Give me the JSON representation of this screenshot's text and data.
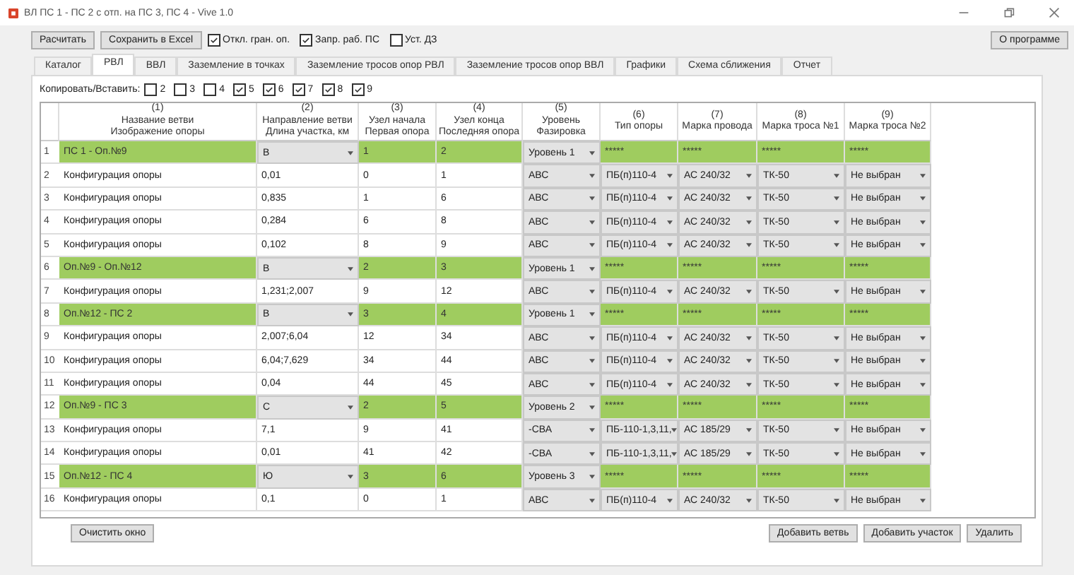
{
  "window": {
    "title": "ВЛ ПС 1 - ПС 2 с отп. на ПС 3, ПС 4 - Vive 1.0"
  },
  "toolbar": {
    "buttons": [
      "Расчитать",
      "Сохранить в Excel"
    ],
    "checks": [
      {
        "label": "Откл. гран. оп.",
        "checked": true
      },
      {
        "label": "Запр. раб. ПС",
        "checked": true
      },
      {
        "label": "Уст. ДЗ",
        "checked": false
      }
    ],
    "about": "О программе"
  },
  "tabs": [
    {
      "label": "Каталог",
      "selected": false
    },
    {
      "label": "РВЛ",
      "selected": true
    },
    {
      "label": "ВВЛ",
      "selected": false
    },
    {
      "label": "Заземление в точках",
      "selected": false
    },
    {
      "label": "Заземление тросов опор РВЛ",
      "selected": false
    },
    {
      "label": "Заземление тросов опор ВВЛ",
      "selected": false
    },
    {
      "label": "Графики",
      "selected": false
    },
    {
      "label": "Схема сближения",
      "selected": false
    },
    {
      "label": "Отчет",
      "selected": false
    }
  ],
  "copy": {
    "label": "Копировать/Вставить:",
    "checks": [
      {
        "label": "2",
        "checked": false
      },
      {
        "label": "3",
        "checked": false
      },
      {
        "label": "4",
        "checked": false
      },
      {
        "label": "5",
        "checked": true
      },
      {
        "label": "6",
        "checked": true
      },
      {
        "label": "7",
        "checked": true
      },
      {
        "label": "8",
        "checked": true
      },
      {
        "label": "9",
        "checked": true
      }
    ]
  },
  "table": {
    "columns": [
      {
        "number": "(1)",
        "lines": [
          "Название ветви",
          "Изображение опоры"
        ]
      },
      {
        "number": "(2)",
        "lines": [
          "Направление ветви",
          "Длина участка, км"
        ]
      },
      {
        "number": "(3)",
        "lines": [
          "Узел начала",
          "Первая опора"
        ]
      },
      {
        "number": "(4)",
        "lines": [
          "Узел конца",
          "Последняя опора"
        ]
      },
      {
        "number": "(5)",
        "lines": [
          "Уровень",
          "Фазировка"
        ]
      },
      {
        "number": "(6)",
        "lines": [
          "Тип опоры"
        ]
      },
      {
        "number": "(7)",
        "lines": [
          "Марка провода"
        ]
      },
      {
        "number": "(8)",
        "lines": [
          "Марка троса №1"
        ]
      },
      {
        "number": "(9)",
        "lines": [
          "Марка троса №2"
        ]
      }
    ],
    "rows": [
      {
        "kind": "branch",
        "num": "1",
        "cells": [
          "ПС 1 - Оп.№9",
          "В",
          "1",
          "2",
          "Уровень 1",
          "*****",
          "*****",
          "*****",
          "*****"
        ]
      },
      {
        "kind": "section",
        "num": "2",
        "cells": [
          "Конфигурация опоры",
          "0,01",
          "0",
          "1",
          "АВС",
          "ПБ(п)110-4",
          "АС 240/32",
          "ТК-50",
          "Не выбран"
        ]
      },
      {
        "kind": "section",
        "num": "3",
        "cells": [
          "Конфигурация опоры",
          "0,835",
          "1",
          "6",
          "АВС",
          "ПБ(п)110-4",
          "АС 240/32",
          "ТК-50",
          "Не выбран"
        ]
      },
      {
        "kind": "section",
        "num": "4",
        "cells": [
          "Конфигурация опоры",
          "0,284",
          "6",
          "8",
          "АВС",
          "ПБ(п)110-4",
          "АС 240/32",
          "ТК-50",
          "Не выбран"
        ]
      },
      {
        "kind": "section",
        "num": "5",
        "cells": [
          "Конфигурация опоры",
          "0,102",
          "8",
          "9",
          "АВС",
          "ПБ(п)110-4",
          "АС 240/32",
          "ТК-50",
          "Не выбран"
        ]
      },
      {
        "kind": "branch",
        "num": "6",
        "cells": [
          "Оп.№9 - Оп.№12",
          "В",
          "2",
          "3",
          "Уровень 1",
          "*****",
          "*****",
          "*****",
          "*****"
        ]
      },
      {
        "kind": "section",
        "num": "7",
        "cells": [
          "Конфигурация опоры",
          "1,231;2,007",
          "9",
          "12",
          "АВС",
          "ПБ(п)110-4",
          "АС 240/32",
          "ТК-50",
          "Не выбран"
        ]
      },
      {
        "kind": "branch",
        "num": "8",
        "cells": [
          "Оп.№12 - ПС 2",
          "В",
          "3",
          "4",
          "Уровень 1",
          "*****",
          "*****",
          "*****",
          "*****"
        ]
      },
      {
        "kind": "section",
        "num": "9",
        "cells": [
          "Конфигурация опоры",
          "2,007;6,04",
          "12",
          "34",
          "АВС",
          "ПБ(п)110-4",
          "АС 240/32",
          "ТК-50",
          "Не выбран"
        ]
      },
      {
        "kind": "section",
        "num": "10",
        "cells": [
          "Конфигурация опоры",
          "6,04;7,629",
          "34",
          "44",
          "АВС",
          "ПБ(п)110-4",
          "АС 240/32",
          "ТК-50",
          "Не выбран"
        ]
      },
      {
        "kind": "section",
        "num": "11",
        "cells": [
          "Конфигурация опоры",
          "0,04",
          "44",
          "45",
          "АВС",
          "ПБ(п)110-4",
          "АС 240/32",
          "ТК-50",
          "Не выбран"
        ]
      },
      {
        "kind": "branch",
        "num": "12",
        "cells": [
          "Оп.№9 - ПС 3",
          "С",
          "2",
          "5",
          "Уровень 2",
          "*****",
          "*****",
          "*****",
          "*****"
        ]
      },
      {
        "kind": "section",
        "num": "13",
        "cells": [
          "Конфигурация опоры",
          "7,1",
          "9",
          "41",
          "-СВА",
          "ПБ-110-1,3,11,",
          "АС 185/29",
          "ТК-50",
          "Не выбран"
        ]
      },
      {
        "kind": "section",
        "num": "14",
        "cells": [
          "Конфигурация опоры",
          "0,01",
          "41",
          "42",
          "-СВА",
          "ПБ-110-1,3,11,",
          "АС 185/29",
          "ТК-50",
          "Не выбран"
        ]
      },
      {
        "kind": "branch",
        "num": "15",
        "cells": [
          "Оп.№12 - ПС 4",
          "Ю",
          "3",
          "6",
          "Уровень 3",
          "*****",
          "*****",
          "*****",
          "*****"
        ]
      },
      {
        "kind": "section",
        "num": "16",
        "cells": [
          "Конфигурация опоры",
          "0,1",
          "0",
          "1",
          "АВС",
          "ПБ(п)110-4",
          "АС 240/32",
          "ТК-50",
          "Не выбран"
        ]
      }
    ]
  },
  "bottom": {
    "left": [
      "Очистить окно"
    ],
    "right": [
      "Добавить ветвь",
      "Добавить участок",
      "Удалить"
    ]
  }
}
